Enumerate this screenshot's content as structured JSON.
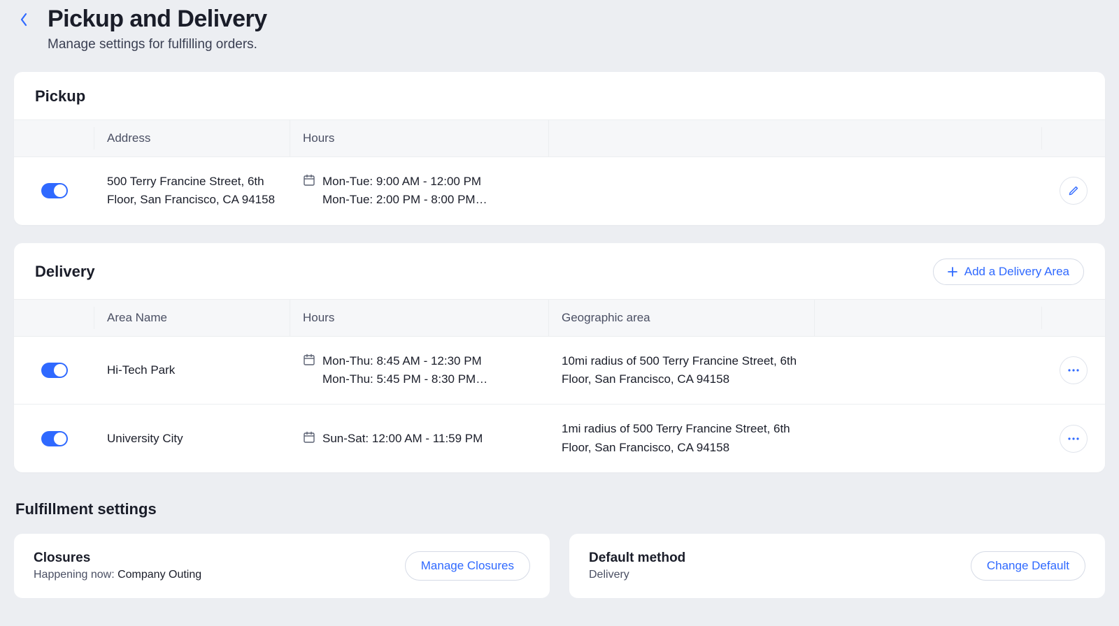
{
  "header": {
    "title": "Pickup and Delivery",
    "subtitle": "Manage settings for fulfilling orders."
  },
  "pickup": {
    "title": "Pickup",
    "columns": {
      "address": "Address",
      "hours": "Hours"
    },
    "rows": [
      {
        "enabled": true,
        "address": "500 Terry Francine Street, 6th Floor, San Francisco, CA 94158",
        "hours_line1": "Mon-Tue: 9:00 AM - 12:00 PM",
        "hours_line2": "Mon-Tue: 2:00 PM - 8:00 PM…"
      }
    ]
  },
  "delivery": {
    "title": "Delivery",
    "add_label": "Add a Delivery Area",
    "columns": {
      "name": "Area Name",
      "hours": "Hours",
      "geo": "Geographic area"
    },
    "rows": [
      {
        "enabled": true,
        "name": "Hi-Tech Park",
        "hours_line1": "Mon-Thu: 8:45 AM - 12:30 PM",
        "hours_line2": "Mon-Thu: 5:45 PM - 8:30 PM…",
        "geo": "10mi radius of 500 Terry Francine Street, 6th Floor, San Francisco, CA 94158"
      },
      {
        "enabled": true,
        "name": "University City",
        "hours_line1": "Sun-Sat: 12:00 AM - 11:59 PM",
        "hours_line2": "",
        "geo": "1mi radius of 500 Terry Francine Street, 6th Floor, San Francisco, CA 94158"
      }
    ]
  },
  "fulfillment": {
    "title": "Fulfillment settings",
    "closures": {
      "title": "Closures",
      "sub_prefix": "Happening now: ",
      "sub_value": "Company Outing",
      "button": "Manage Closures"
    },
    "default_method": {
      "title": "Default method",
      "value": "Delivery",
      "button": "Change Default"
    }
  }
}
